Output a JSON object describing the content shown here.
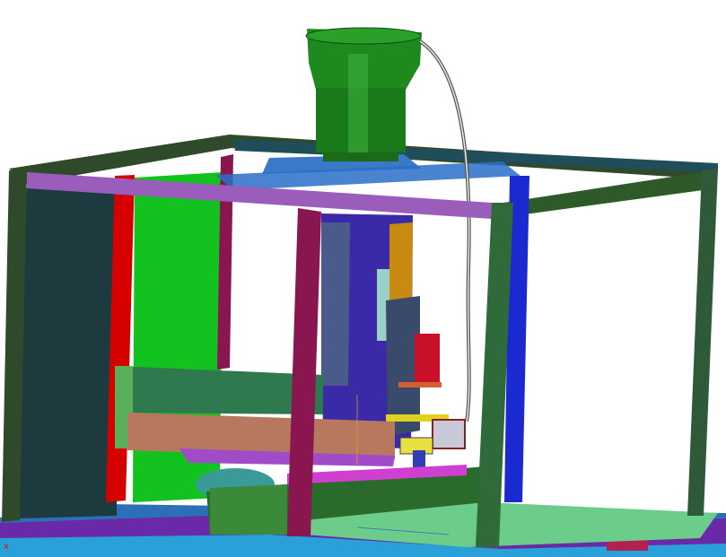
{
  "viewport": {
    "background": "#ffffff",
    "axis_triad_label": "x"
  },
  "colors": {
    "frame_dark": "#2e4a2a",
    "frame_purple": "#9a5cb8",
    "post_red": "#d40000",
    "post_maroon": "#8a1650",
    "green_panel": "#10c020",
    "dark_panel": "#1c3a3e",
    "feeder_bowl": "#1f8a1f",
    "base_plate": "#66cc88",
    "slide_blue": "#2a2ab0",
    "slab_tan": "#b87860"
  }
}
